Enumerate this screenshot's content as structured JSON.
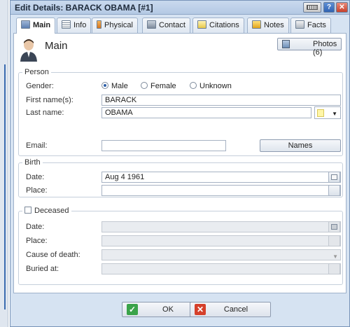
{
  "window": {
    "title": "Edit Details: BARACK OBAMA [#1]"
  },
  "tabs": [
    {
      "label": "Main",
      "icon": "id-card-icon"
    },
    {
      "label": "Info",
      "icon": "list-icon"
    },
    {
      "label": "Physical",
      "icon": "figure-icon"
    },
    {
      "label": "Contact",
      "icon": "house-icon"
    },
    {
      "label": "Citations",
      "icon": "citation-icon"
    },
    {
      "label": "Notes",
      "icon": "notes-icon"
    },
    {
      "label": "Facts",
      "icon": "facts-icon"
    }
  ],
  "header": {
    "title": "Main",
    "photos_button": "Photos (6)"
  },
  "person": {
    "group_title": "Person",
    "gender_label": "Gender:",
    "gender_options": [
      "Male",
      "Female",
      "Unknown"
    ],
    "gender_selected": "Male",
    "first_name_label": "First name(s):",
    "first_name_value": "BARACK",
    "last_name_label": "Last name:",
    "last_name_value": "OBAMA",
    "email_label": "Email:",
    "email_value": "",
    "names_button": "Names",
    "color_swatch": "#fff6a8"
  },
  "birth": {
    "group_title": "Birth",
    "date_label": "Date:",
    "date_value": "Aug 4 1961",
    "place_label": "Place:",
    "place_value": ""
  },
  "deceased": {
    "group_title": "Deceased",
    "checked": false,
    "date_label": "Date:",
    "place_label": "Place:",
    "cause_label": "Cause of death:",
    "buried_label": "Buried at:"
  },
  "footer": {
    "ok_label": "OK",
    "cancel_label": "Cancel"
  },
  "colors": {
    "titlebar": "#b4c9e4",
    "ok_green": "#3aa34a",
    "cancel_red": "#d5402b"
  }
}
